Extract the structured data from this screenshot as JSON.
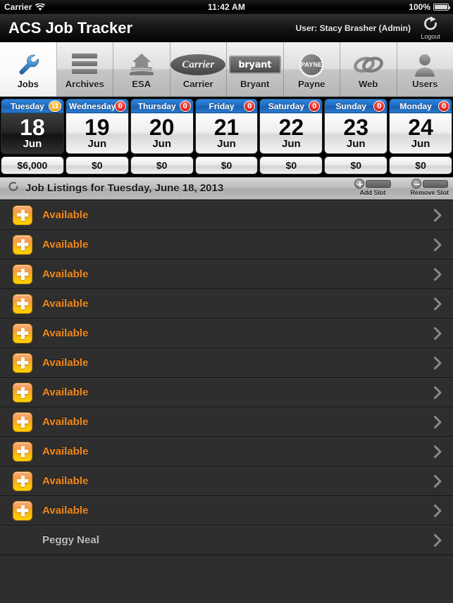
{
  "statusbar": {
    "carrier": "Carrier",
    "wifi_icon": "wifi-icon",
    "time": "11:42 AM",
    "battery_percent": "100%",
    "battery_icon": "battery-full-icon"
  },
  "header": {
    "app_title": "ACS Job Tracker",
    "user_label": "User: Stacy Brasher (Admin)",
    "logout_label": "Logout",
    "logout_icon": "logout-arrow-icon"
  },
  "tabbar": {
    "tabs": [
      {
        "label": "Jobs",
        "icon": "wrench-icon",
        "selected": true
      },
      {
        "label": "Archives",
        "icon": "archive-bars-icon",
        "selected": false
      },
      {
        "label": "ESA",
        "icon": "house-icon",
        "selected": false
      },
      {
        "label": "Carrier",
        "icon": "carrier-logo-icon",
        "logo_text": "Carrier",
        "selected": false
      },
      {
        "label": "Bryant",
        "icon": "bryant-logo-icon",
        "logo_text": "bryant",
        "selected": false
      },
      {
        "label": "Payne",
        "icon": "payne-logo-icon",
        "logo_text": "PAYNE",
        "selected": false
      },
      {
        "label": "Web",
        "icon": "chain-links-icon",
        "selected": false
      },
      {
        "label": "Users",
        "icon": "person-icon",
        "selected": false
      }
    ]
  },
  "datestrip": {
    "days": [
      {
        "weekday": "Tuesday",
        "day": "18",
        "month": "Jun",
        "badge": "11",
        "badge_color": "#f0a010",
        "amount": "$6,000",
        "selected": true
      },
      {
        "weekday": "Wednesday",
        "day": "19",
        "month": "Jun",
        "badge": "0",
        "badge_color": "#e1201a",
        "amount": "$0",
        "selected": false
      },
      {
        "weekday": "Thursday",
        "day": "20",
        "month": "Jun",
        "badge": "0",
        "badge_color": "#e1201a",
        "amount": "$0",
        "selected": false
      },
      {
        "weekday": "Friday",
        "day": "21",
        "month": "Jun",
        "badge": "0",
        "badge_color": "#e1201a",
        "amount": "$0",
        "selected": false
      },
      {
        "weekday": "Saturday",
        "day": "22",
        "month": "Jun",
        "badge": "0",
        "badge_color": "#e1201a",
        "amount": "$0",
        "selected": false
      },
      {
        "weekday": "Sunday",
        "day": "23",
        "month": "Jun",
        "badge": "0",
        "badge_color": "#e1201a",
        "amount": "$0",
        "selected": false
      },
      {
        "weekday": "Monday",
        "day": "24",
        "month": "Jun",
        "badge": "0",
        "badge_color": "#e1201a",
        "amount": "$0",
        "selected": false
      }
    ]
  },
  "listheader": {
    "refresh_icon": "refresh-spinner-icon",
    "title": "Job Listings for Tuesday, June 18, 2013",
    "add_slot_label": "Add Slot",
    "remove_slot_label": "Remove Slot"
  },
  "joblist": {
    "rows": [
      {
        "label": "Available",
        "icon": "plus-icon",
        "type": "available"
      },
      {
        "label": "Available",
        "icon": "plus-icon",
        "type": "available"
      },
      {
        "label": "Available",
        "icon": "plus-icon",
        "type": "available"
      },
      {
        "label": "Available",
        "icon": "plus-icon",
        "type": "available"
      },
      {
        "label": "Available",
        "icon": "plus-icon",
        "type": "available"
      },
      {
        "label": "Available",
        "icon": "plus-icon",
        "type": "available"
      },
      {
        "label": "Available",
        "icon": "plus-icon",
        "type": "available"
      },
      {
        "label": "Available",
        "icon": "plus-icon",
        "type": "available"
      },
      {
        "label": "Available",
        "icon": "plus-icon",
        "type": "available"
      },
      {
        "label": "Available",
        "icon": "plus-icon",
        "type": "available"
      },
      {
        "label": "Available",
        "icon": "plus-icon",
        "type": "available"
      },
      {
        "label": "Peggy Neal",
        "icon": null,
        "type": "assigned"
      }
    ],
    "chevron_icon": "chevron-right-icon"
  },
  "colors": {
    "accent_orange": "#f08a1e",
    "header_blue": "#1e6dc4",
    "badge_red": "#e1201a",
    "badge_amber": "#f0a010",
    "list_bg": "#2e2e2e"
  }
}
